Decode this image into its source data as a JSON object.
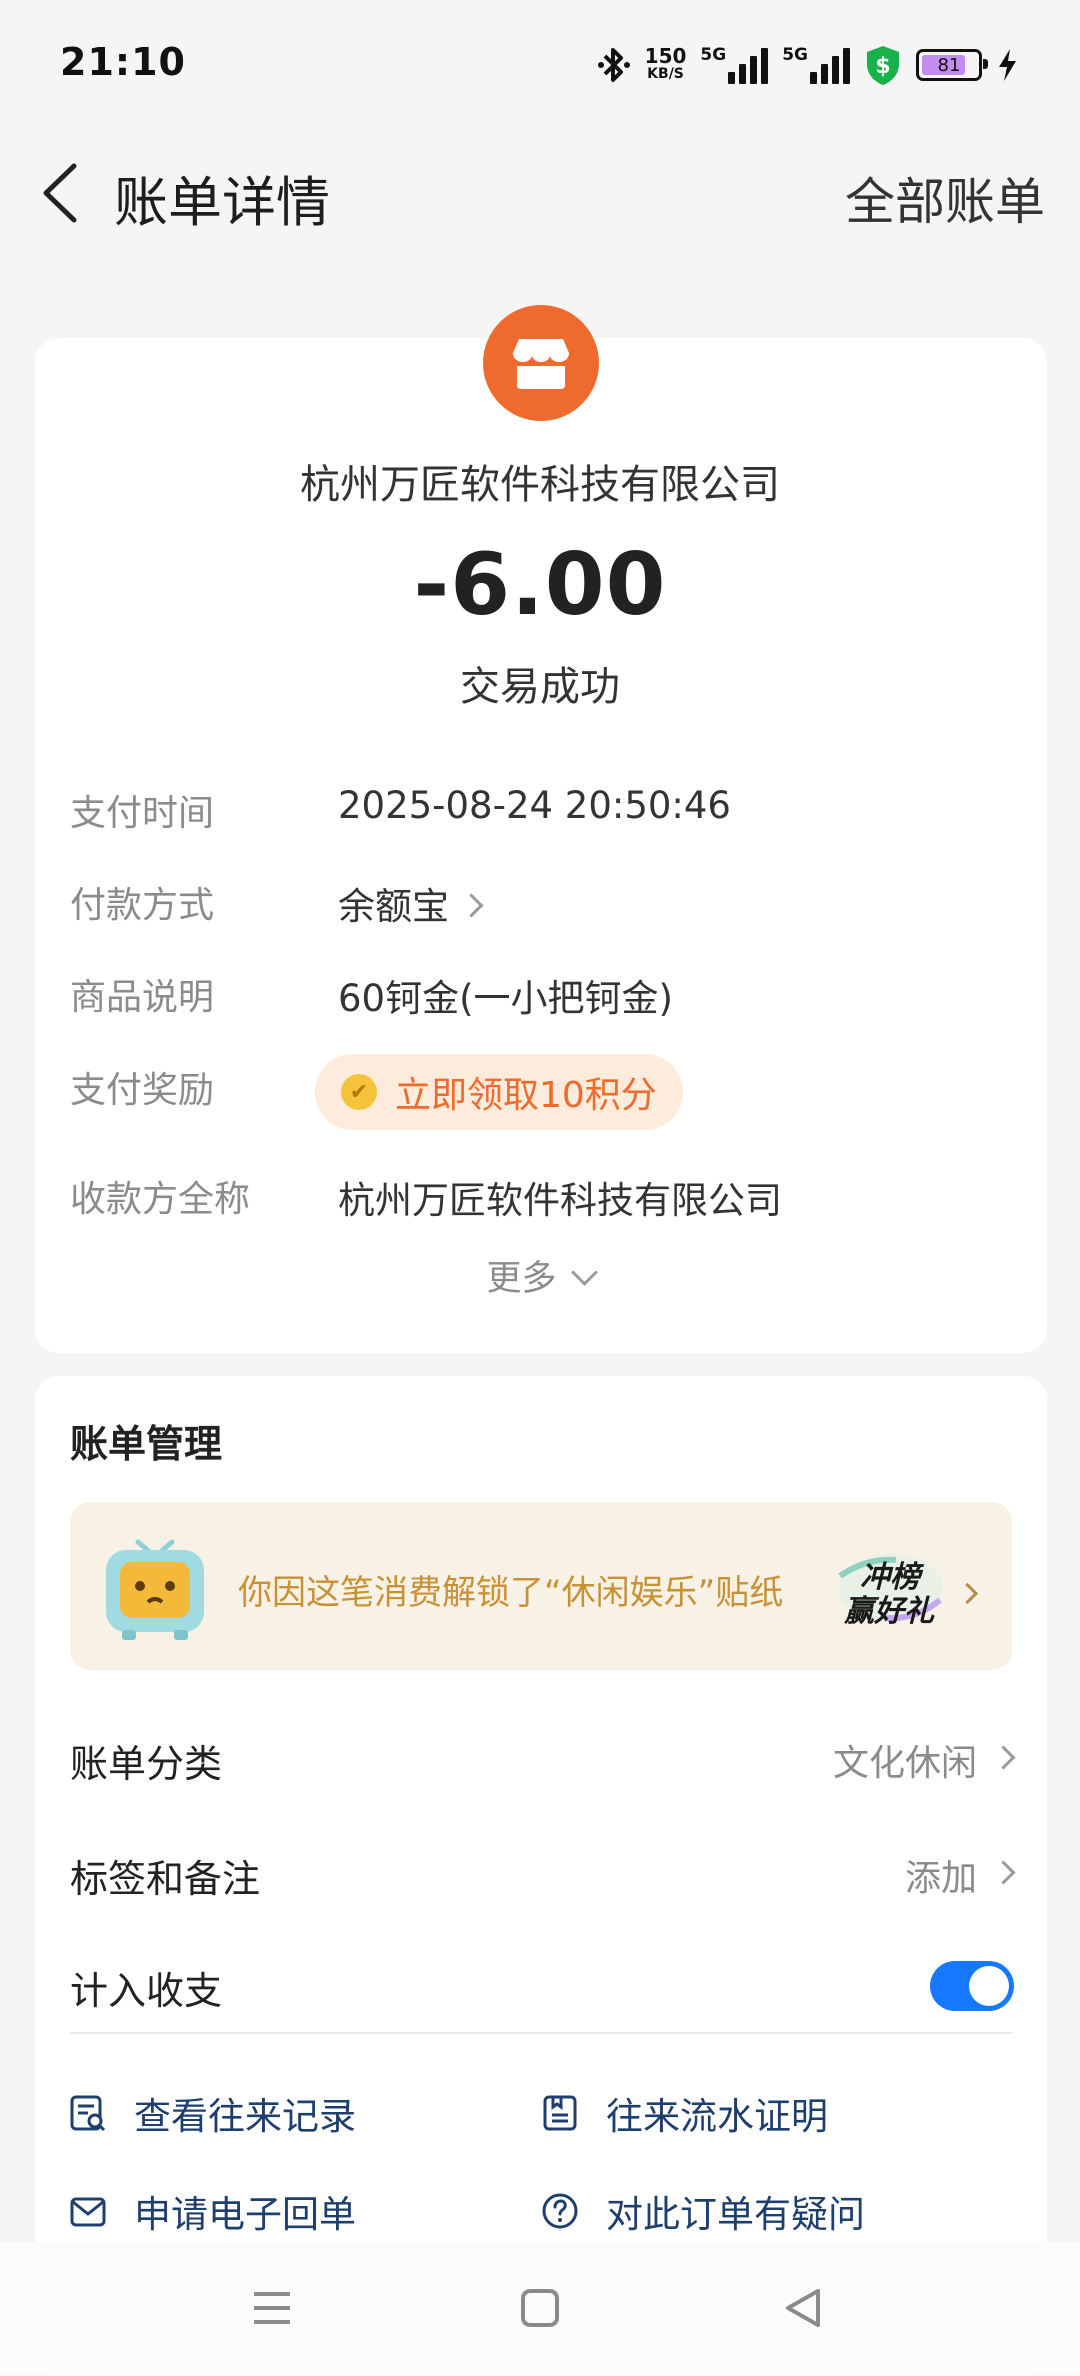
{
  "status_bar": {
    "time": "21:10",
    "net_speed_value": "150",
    "net_speed_unit": "KB/S",
    "net1": "5G",
    "net2": "5G",
    "battery": "81",
    "battery_level_percent": 81,
    "icons": [
      "bluetooth-icon",
      "signal-icon",
      "shield-dollar-icon",
      "battery-icon",
      "charging-icon"
    ]
  },
  "header": {
    "title": "账单详情",
    "right_link": "全部账单"
  },
  "bill": {
    "merchant": "杭州万匠软件科技有限公司",
    "amount": "-6.00",
    "status": "交易成功",
    "rows": [
      {
        "label": "支付时间",
        "value": "2025-08-24 20:50:46"
      },
      {
        "label": "付款方式",
        "value": "余额宝"
      },
      {
        "label": "商品说明",
        "value": "60钶金(一小把钶金)"
      },
      {
        "label": "支付奖励",
        "value": "立即领取10积分"
      },
      {
        "label": "收款方全称",
        "value": "杭州万匠软件科技有限公司"
      }
    ],
    "more": "更多"
  },
  "management": {
    "title": "账单管理",
    "banner_text": "你因这笔消费解锁了“休闲娱乐”贴纸",
    "banner_badge_line1": "冲榜",
    "banner_badge_line2": "赢好礼",
    "category_label": "账单分类",
    "category_value": "文化休闲",
    "tag_label": "标签和备注",
    "tag_value": "添加",
    "include_label": "计入收支",
    "include_on": true,
    "links": [
      {
        "label": "查看往来记录",
        "icon": "record-search-icon"
      },
      {
        "label": "往来流水证明",
        "icon": "statement-icon"
      },
      {
        "label": "申请电子回单",
        "icon": "envelope-icon"
      },
      {
        "label": "对此订单有疑问",
        "icon": "question-icon"
      }
    ]
  },
  "colors": {
    "accent": "#1677ff",
    "merchant": "#ef6a2d",
    "reward_text": "#ef6a2d",
    "reward_bg": "#fdebdb",
    "banner_text": "#c89134",
    "link_text": "#1e3f6e"
  }
}
